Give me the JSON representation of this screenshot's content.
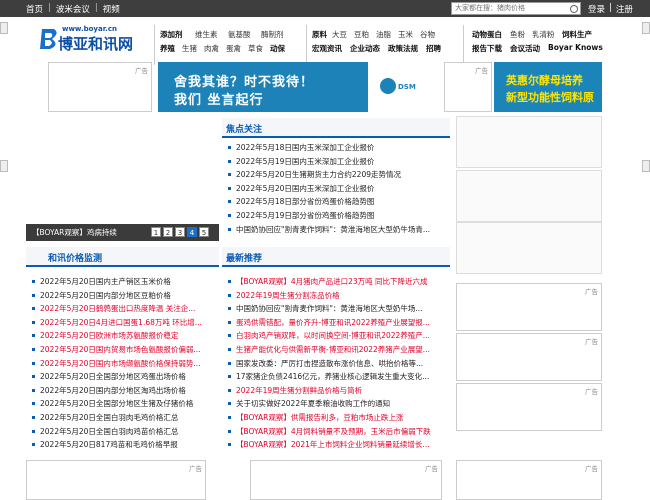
{
  "topbar": {
    "nav": [
      "首页",
      "波米会议",
      "视频"
    ],
    "separators": [
      "|",
      "|"
    ],
    "search_placeholder": "大家都在搜：猪肉价格",
    "auth": [
      "登录",
      "|",
      "注册"
    ]
  },
  "logo": {
    "url": "www.boyar.cn",
    "name": "博亚和讯网"
  },
  "menu": {
    "group1_row1": [
      "添加剂",
      "维生素",
      "氨基酸",
      "酶制剂"
    ],
    "group1_row2": [
      "养殖",
      "生猪",
      "肉禽",
      "蛋禽",
      "草食",
      "动保"
    ],
    "group2_row1": [
      "原料",
      "大豆",
      "豆粕",
      "油脂",
      "玉米",
      "谷物"
    ],
    "group2_row2": [
      "宏观资讯",
      "企业动态",
      "政策法规",
      "招聘"
    ],
    "group3_row1": [
      "动物蛋白",
      "鱼粉",
      "乳清粉",
      "饲料生产"
    ],
    "group3_row2": [
      "报告下载",
      "会议活动",
      "Boyar Knows"
    ]
  },
  "ads": {
    "label": "广告",
    "banner1_line1": "舍我其谁？时不我待！",
    "banner1_line2": "我们 坐言起行",
    "banner1_brand": "DSM",
    "banner2_line1": "英惠尔酵母培养",
    "banner2_line2": "新型功能性饲料原"
  },
  "slideshow": {
    "caption": "【BOYAR观察】鸡病持续",
    "pages": [
      "1",
      "2",
      "3",
      "4",
      "5"
    ],
    "active_page": "4"
  },
  "focus": {
    "title": "焦点关注",
    "items": [
      "2022年5月18日国内玉米深加工企业报价",
      "2022年5月19日国内玉米深加工企业报价",
      "2022年5月20日生猪期货主力合约2209走势情况",
      "2022年5月20日国内玉米深加工企业报价",
      "2022年5月18日部分省份鸡蛋价格趋势图",
      "2022年5月19日部分省份鸡蛋价格趋势图",
      "中国奶协回应\"割青麦作饲料\"：黄淮海地区大型奶牛场青..."
    ]
  },
  "price": {
    "title": "和讯价格监测",
    "items": [
      {
        "text": "2022年5月20日国内主产销区玉米价格",
        "red": false
      },
      {
        "text": "2022年5月20日国内部分地区豆粕价格",
        "red": false
      },
      {
        "text": "2022年5月20日鹤鹑蛋出口热度降温 关注企...",
        "red": true
      },
      {
        "text": "2022年5月20日4月进口国蛋1.68万吨 环比增...",
        "red": true
      },
      {
        "text": "2022年5月20日欧洲市场苏氨酸报价稳定",
        "red": true
      },
      {
        "text": "2022年5月20日国内贸易市场色氨酸报价偏弱...",
        "red": true
      },
      {
        "text": "2022年5月20日国内市场缬氨酸价格保持弱势...",
        "red": true
      },
      {
        "text": "2022年5月20日全国部分地区鸡蛋出场价格",
        "red": false
      },
      {
        "text": "2022年5月20日国内部分地区淘鸡出场价格",
        "red": false
      },
      {
        "text": "2022年5月20日全国部分地区生猪及仔猪价格",
        "red": false
      },
      {
        "text": "2022年5月20日全国白羽肉毛鸡价格汇总",
        "red": false
      },
      {
        "text": "2022年5月20日全国白羽肉鸡苗价格汇总",
        "red": false
      },
      {
        "text": "2022年5月20日817鸡苗和毛鸡价格早报",
        "red": false
      }
    ]
  },
  "recommend": {
    "title": "最新推荐",
    "items": [
      {
        "text": "【BOYAR观察】4月猪肉产品进口23万吨 同比下降近六成",
        "red": true
      },
      {
        "text": "2022年19周生猪分割冻品价格",
        "red": true
      },
      {
        "text": "中国奶协回应\"割青麦作饲料\"：黄淮海地区大型奶牛场...",
        "red": false
      },
      {
        "text": "蛋鸡供需错配，量价齐升-博亚和讯2022养殖产业展望报...",
        "red": true
      },
      {
        "text": "白羽肉鸡产销双降，以时间换空间-博亚和讯2022养殖产...",
        "red": true
      },
      {
        "text": "生猪产能优化与供需新平衡-博亚和讯2022养猪产业展望...",
        "red": true
      },
      {
        "text": "国家发改委：严厉打击捏造散布涨价信息、哄抬价格等...",
        "red": false
      },
      {
        "text": "17家猪企负债2416亿元，养猪业核心逻辑发生重大变化...",
        "red": false
      },
      {
        "text": "2022年19周生猪分割鲜品价格与简析",
        "red": true
      },
      {
        "text": "关于切实做好2022年夏季粮油收购工作的通知",
        "red": false
      },
      {
        "text": "【BOYAR观察】供需报告利多，豆粕市场止跌上涨",
        "red": true
      },
      {
        "text": "【BOYAR观察】4月饲料销量不及预期，玉米后市偏弱下跌",
        "red": true
      },
      {
        "text": "【BOYAR观察】2021年上市饲料企业饲料销量延续增长...",
        "red": true
      }
    ]
  },
  "colors": {
    "topbar": "#3e3e3e",
    "brand_blue": "#0a5bb5",
    "red_link": "#e0002a",
    "banner_blue": "#1c82b8",
    "banner_yellow": "#ffe400"
  }
}
